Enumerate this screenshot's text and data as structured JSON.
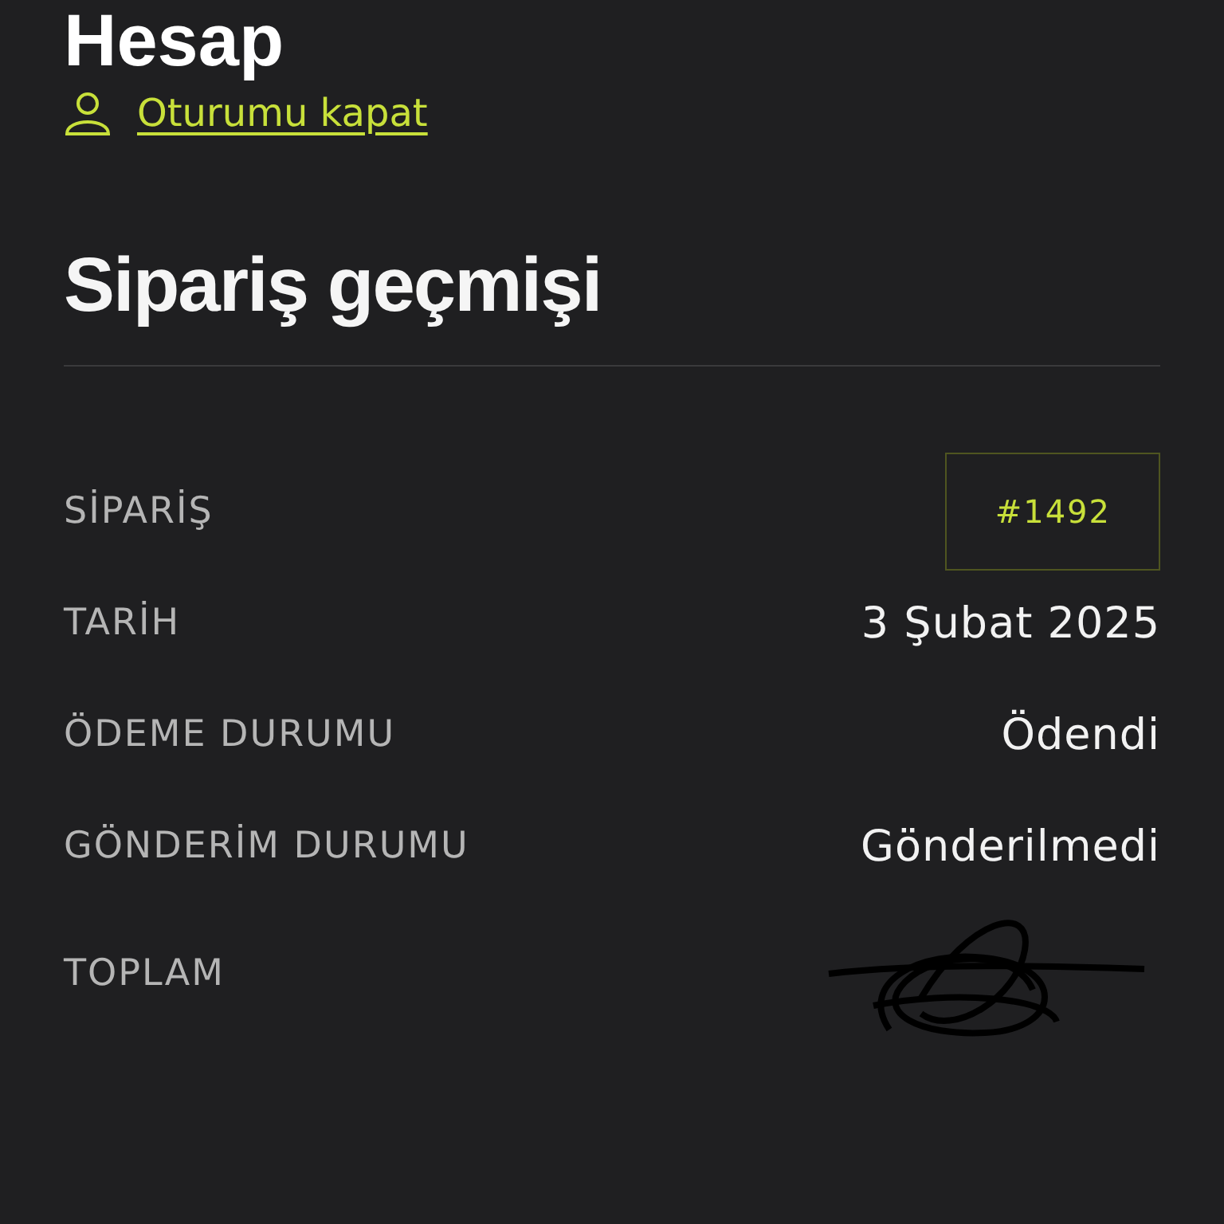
{
  "account_title": "Hesap",
  "logout_link": "Oturumu kapat",
  "section_title": "Sipariş geçmişi",
  "order_rows": [
    {
      "kind": "badge",
      "label": "SİPARİŞ",
      "value": "#1492"
    },
    {
      "kind": "text",
      "label": "TARİH",
      "value": "3 Şubat 2025"
    },
    {
      "kind": "text",
      "label": "ÖDEME DURUMU",
      "value": "Ödendi"
    },
    {
      "kind": "text",
      "label": "GÖNDERİM DURUMU",
      "value": "Gönderilmedi"
    },
    {
      "kind": "redacted",
      "label": "TOPLAM"
    }
  ]
}
